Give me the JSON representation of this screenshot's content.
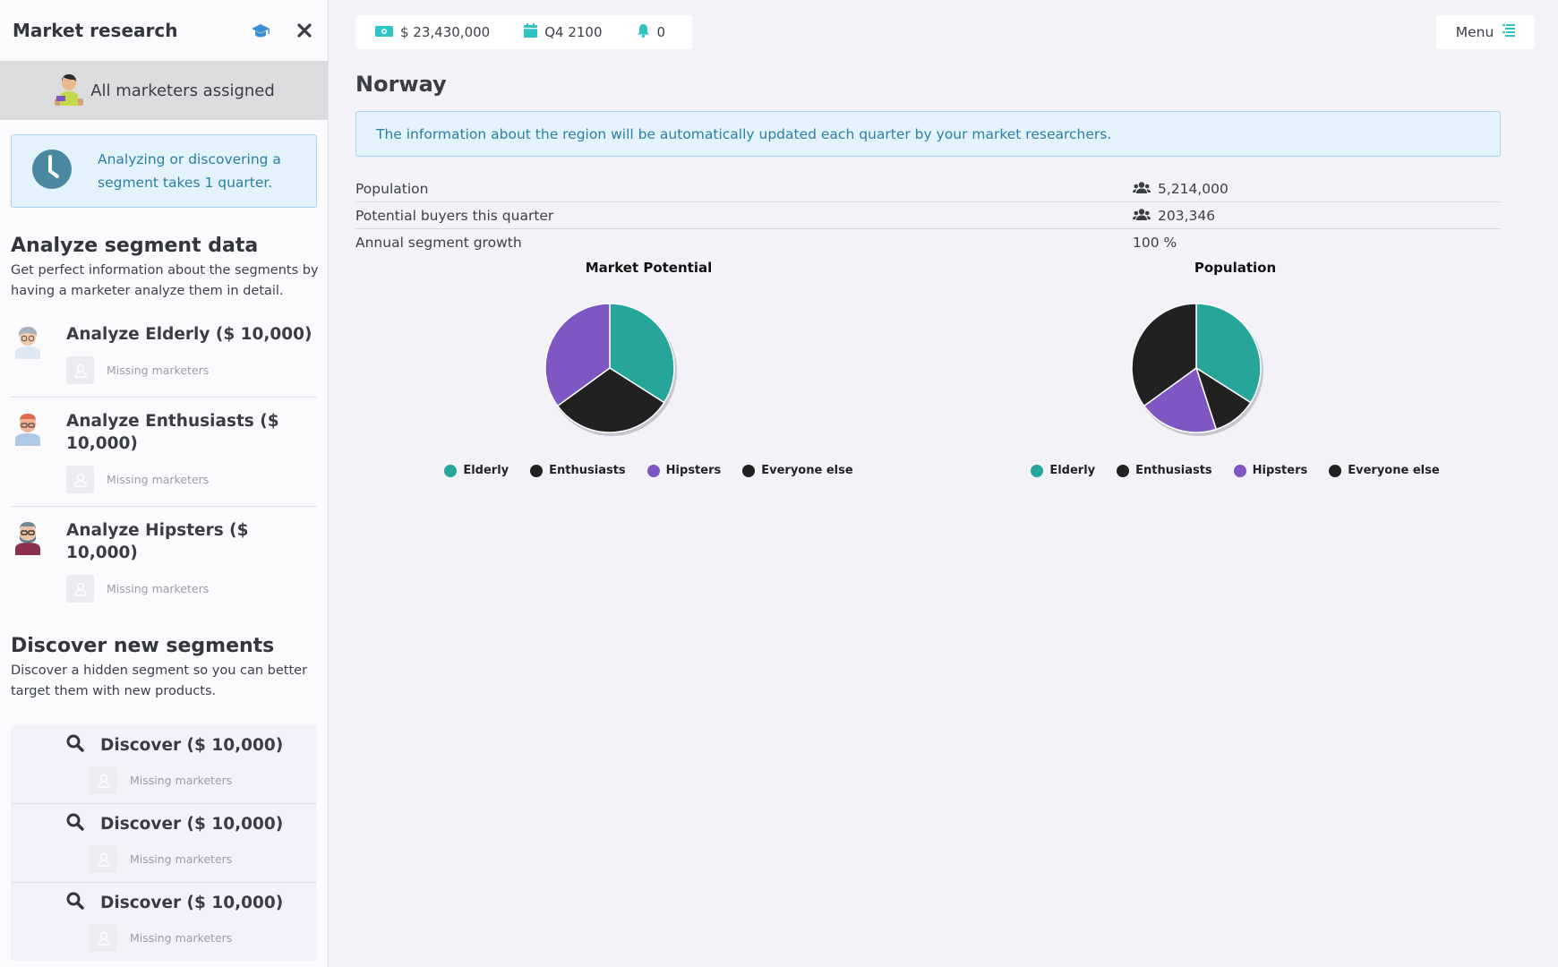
{
  "sidebar": {
    "title": "Market research",
    "assigned_text": "All marketers assigned",
    "info_text": "Analyzing or discovering a segment takes 1 quarter.",
    "analyze": {
      "heading": "Analyze segment data",
      "description": "Get perfect information about the segments by having a marketer analyze them in detail.",
      "items": [
        {
          "title": "Analyze Elderly ($ 10,000)",
          "status": "Missing marketers"
        },
        {
          "title": "Analyze Enthusiasts ($ 10,000)",
          "status": "Missing marketers"
        },
        {
          "title": "Analyze Hipsters ($ 10,000)",
          "status": "Missing marketers"
        }
      ]
    },
    "discover": {
      "heading": "Discover new segments",
      "description": "Discover a hidden segment so you can better target them with new products.",
      "items": [
        {
          "title": "Discover ($ 10,000)",
          "status": "Missing marketers"
        },
        {
          "title": "Discover ($ 10,000)",
          "status": "Missing marketers"
        },
        {
          "title": "Discover ($ 10,000)",
          "status": "Missing marketers"
        }
      ]
    }
  },
  "topbar": {
    "money": "$ 23,430,000",
    "quarter": "Q4 2100",
    "notifications": "0",
    "menu_label": "Menu"
  },
  "region": {
    "name": "Norway",
    "notice": "The information about the region will be automatically updated each quarter by your market researchers.",
    "stats": [
      {
        "label": "Population",
        "value": "5,214,000",
        "icon": "users-icon"
      },
      {
        "label": "Potential buyers this quarter",
        "value": "203,346",
        "icon": "users-icon"
      },
      {
        "label": "Annual segment growth",
        "value": "100 %",
        "icon": ""
      }
    ]
  },
  "colors": {
    "accent": "#2ec4c4",
    "teal": "#26a69a",
    "dark": "#212121",
    "purple": "#7e57c2",
    "info_bg": "#e4f2fb",
    "info_text": "#2b7fa4"
  },
  "chart_data": [
    {
      "type": "pie",
      "title": "Market Potential",
      "categories": [
        "Elderly",
        "Enthusiasts",
        "Hipsters",
        "Everyone else"
      ],
      "values": [
        34,
        31,
        35,
        0
      ],
      "colors": [
        "#26a69a",
        "#212121",
        "#7e57c2",
        "#212121"
      ],
      "legend": "bottom"
    },
    {
      "type": "pie",
      "title": "Population",
      "categories": [
        "Elderly",
        "Enthusiasts",
        "Hipsters",
        "Everyone else"
      ],
      "values": [
        34,
        11,
        20,
        35
      ],
      "colors": [
        "#26a69a",
        "#212121",
        "#7e57c2",
        "#212121"
      ],
      "legend": "bottom"
    }
  ]
}
